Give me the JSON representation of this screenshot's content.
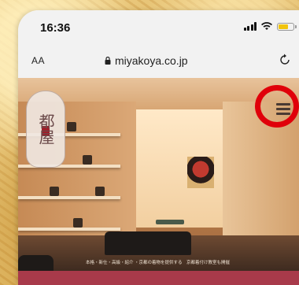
{
  "status_bar": {
    "time": "16:36",
    "icons": [
      "signal-icon",
      "wifi-icon",
      "battery-icon"
    ],
    "battery_color": "#f1c40f"
  },
  "browser": {
    "text_size_label": "AA",
    "address": "miyakoya.co.jp",
    "icons": [
      "lock-icon",
      "reload-icon"
    ]
  },
  "hero": {
    "logo_kanji": "都屋",
    "caption": "本格・新仕・高級・紹介 ・京都の着物を提供する　京都着付け教室も開催"
  },
  "menu": {
    "icon": "hamburger-menu-icon"
  },
  "annotation": {
    "ring_color": "#e0000a"
  },
  "colors": {
    "bottom_bar": "#a83a4a",
    "background": "#e9c77a"
  }
}
